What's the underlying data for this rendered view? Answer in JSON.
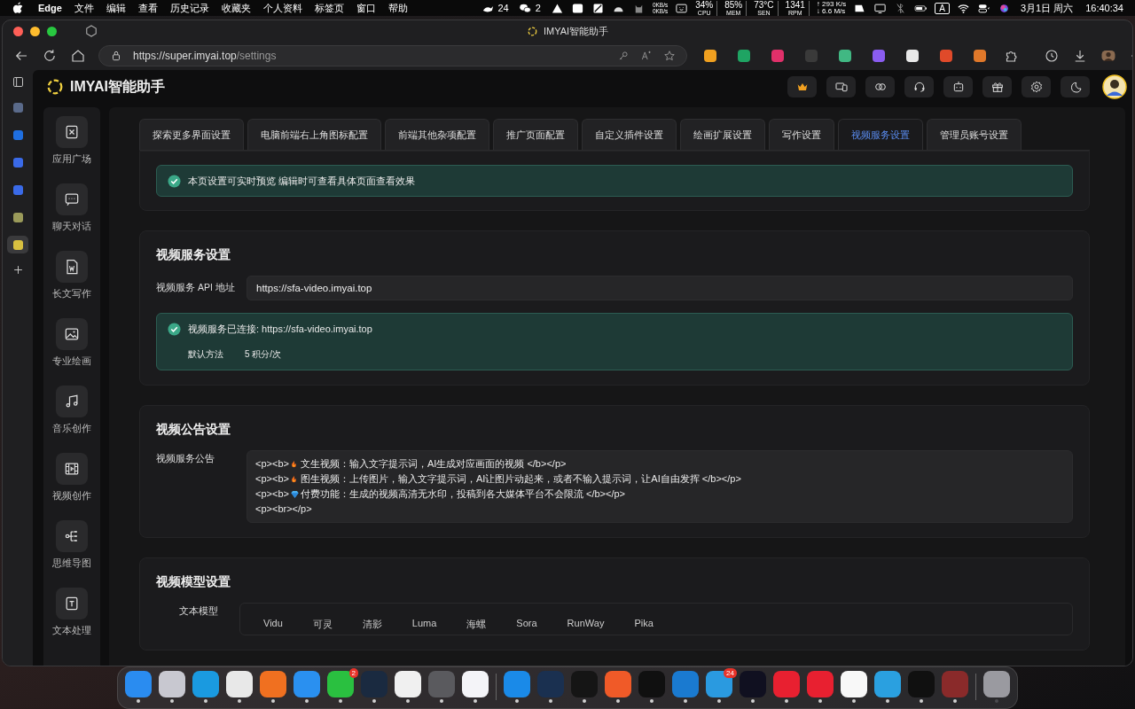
{
  "menu_bar": {
    "app": "Edge",
    "menus": [
      "文件",
      "编辑",
      "查看",
      "历史记录",
      "收藏夹",
      "个人资料",
      "标签页",
      "窗口",
      "帮助"
    ],
    "status": [
      {
        "kind": "cloud",
        "text": "24"
      },
      {
        "kind": "wechat",
        "text": "2"
      }
    ],
    "net": [
      "0KB/s",
      "0KB/s"
    ],
    "stats": [
      {
        "value": "34%",
        "label": "CPU"
      },
      {
        "value": "85%",
        "label": "MEM"
      },
      {
        "value": "73°C",
        "label": "SEN"
      },
      {
        "value": "1341",
        "label": "RPM"
      }
    ],
    "speed": [
      "↑ 293 K/s",
      "↓ 6.6 M/s"
    ],
    "input_source": "A",
    "date": "3月1日 周六",
    "time": "16:40:34"
  },
  "browser": {
    "title": "IMYAI智能助手",
    "url_host": "https://super.imyai.top",
    "url_path": "/settings",
    "extensions": [
      {
        "color": "#f0a020"
      },
      {
        "color": "#1fa463"
      },
      {
        "color": "#e0306a"
      },
      {
        "color": "#3a3a3a"
      },
      {
        "color": "#41b883"
      },
      {
        "color": "#8a5cf0"
      },
      {
        "color": "#e8e8e8"
      },
      {
        "color": "#e04a2a"
      },
      {
        "color": "#e0782a"
      }
    ],
    "vertical_tabs": [
      {
        "color": "#5a6a8a",
        "selected": false
      },
      {
        "color": "#1f6fe0",
        "selected": false
      },
      {
        "color": "#3a6ae8",
        "selected": false
      },
      {
        "color": "#3a6ae8",
        "selected": false
      },
      {
        "color": "#9a9a5a",
        "selected": false
      },
      {
        "color": "#d8c040",
        "selected": true
      }
    ]
  },
  "app": {
    "name": "IMYAI智能助手",
    "header_icons": [
      {
        "kind": "crown"
      },
      {
        "kind": "devices"
      },
      {
        "kind": "link"
      },
      {
        "kind": "headset"
      },
      {
        "kind": "robot"
      },
      {
        "kind": "gift"
      },
      {
        "kind": "gear"
      },
      {
        "kind": "moon"
      }
    ],
    "sidebar": [
      {
        "kind": "apps",
        "label": "应用广场"
      },
      {
        "kind": "chat",
        "label": "聊天对话"
      },
      {
        "kind": "write",
        "label": "长文写作"
      },
      {
        "kind": "image",
        "label": "专业绘画"
      },
      {
        "kind": "music",
        "label": "音乐创作"
      },
      {
        "kind": "video",
        "label": "视频创作"
      },
      {
        "kind": "mindmap",
        "label": "思维导图"
      },
      {
        "kind": "text",
        "label": "文本处理"
      }
    ],
    "tabs": [
      {
        "label": "探索更多界面设置",
        "selected": false
      },
      {
        "label": "电脑前端右上角图标配置",
        "selected": false
      },
      {
        "label": "前端其他杂项配置",
        "selected": false
      },
      {
        "label": "推广页面配置",
        "selected": false
      },
      {
        "label": "自定义插件设置",
        "selected": false
      },
      {
        "label": "绘画扩展设置",
        "selected": false
      },
      {
        "label": "写作设置",
        "selected": false
      },
      {
        "label": "视频服务设置",
        "selected": true
      },
      {
        "label": "管理员账号设置",
        "selected": false
      }
    ],
    "notice": "本页设置可实时预览 编辑时可查看具体页面查看效果",
    "service": {
      "title": "视频服务设置",
      "api_label": "视频服务 API 地址",
      "api_value": "https://sfa-video.imyai.top",
      "status": "视频服务已连接: https://sfa-video.imyai.top",
      "method_label": "默认方法",
      "method_value": "5 积分/次"
    },
    "announcement": {
      "title": "视频公告设置",
      "label": "视频服务公告",
      "lines": [
        {
          "prefix": "<p><b>",
          "kind": "fire",
          "text": "文生视频：输入文字提示词，AI生成对应画面的视频 </b></p>"
        },
        {
          "prefix": "<p><b>",
          "kind": "fire",
          "text": "图生视频：上传图片，输入文字提示词，AI让图片动起来，或者不输入提示词，让AI自由发挥 </b></p>"
        },
        {
          "prefix": "<p><b>",
          "kind": "gem",
          "text": "付费功能：生成的视频高清无水印，投稿到各大媒体平台不会限流 </b></p>"
        },
        {
          "prefix": "<p><br></p>"
        }
      ]
    },
    "models": {
      "title": "视频模型设置",
      "label": "文本模型",
      "items": [
        "Vidu",
        "可灵",
        "清影",
        "Luma",
        "海螺",
        "Sora",
        "RunWay",
        "Pika"
      ]
    }
  },
  "dock": [
    {
      "color": "#2a8cf0",
      "running": true
    },
    {
      "color": "#c8c8d0",
      "running": true
    },
    {
      "color": "#1a9ae0",
      "running": true
    },
    {
      "color": "#e8e8e8",
      "running": true
    },
    {
      "color": "#f07020",
      "running": true
    },
    {
      "color": "#2a90f0",
      "running": true
    },
    {
      "color": "#2ac040",
      "running": true,
      "badge": "2"
    },
    {
      "color": "#1a2a40",
      "running": true
    },
    {
      "color": "#f0f0f0",
      "running": true
    },
    {
      "color": "#5a5a5e",
      "running": true
    },
    {
      "color": "#f4f4f8",
      "running": true
    },
    {
      "color": "#1a8ae8",
      "running": true,
      "separator": true
    },
    {
      "color": "#1a3050",
      "running": true
    },
    {
      "color": "#151515",
      "running": true
    },
    {
      "color": "#f05a28",
      "running": true
    },
    {
      "color": "#101010",
      "running": true
    },
    {
      "color": "#1a7ad0",
      "running": true
    },
    {
      "color": "#2a9ae0",
      "running": true,
      "badge": "24"
    },
    {
      "color": "#101020",
      "running": true
    },
    {
      "color": "#e82030",
      "running": true
    },
    {
      "color": "#e82030",
      "running": true
    },
    {
      "color": "#f8f8f8",
      "running": true
    },
    {
      "color": "#2aa0e0",
      "running": true
    },
    {
      "color": "#101010",
      "running": true
    },
    {
      "color": "#8a2a2a",
      "running": true
    },
    {
      "color": "#9a9aa0",
      "running": false,
      "separator": true
    }
  ]
}
